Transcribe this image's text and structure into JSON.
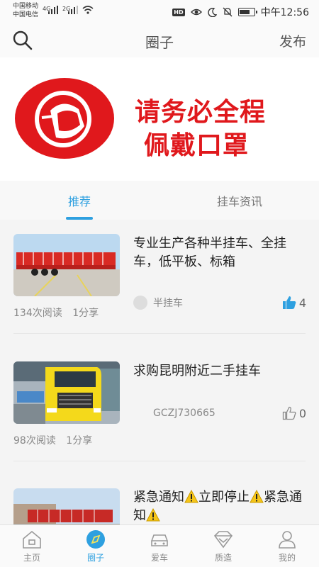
{
  "status_bar": {
    "carrier1": "中国移动",
    "carrier2": "中国电信",
    "net1": "4G",
    "net2": "2G",
    "hd": "HD",
    "time": "中午12:56"
  },
  "header": {
    "title": "圈子",
    "publish_label": "发布"
  },
  "banner": {
    "line1": "请务必全程",
    "line2": "佩戴口罩",
    "accent_color": "#e0181c"
  },
  "tabs": [
    {
      "label": "推荐",
      "active": true
    },
    {
      "label": "挂车资讯",
      "active": false
    }
  ],
  "posts": [
    {
      "title": "专业生产各种半挂车、全挂车，低平板、标箱",
      "author": "半挂车",
      "likes": "4",
      "liked": true,
      "reads": "134次阅读",
      "shares": "1分享"
    },
    {
      "title": "求购昆明附近二手挂车",
      "author": "GCZJ730665",
      "likes": "0",
      "liked": false,
      "reads": "98次阅读",
      "shares": "1分享"
    },
    {
      "title_part1": "紧急通知",
      "title_part2": "立即停止",
      "title_part3": "紧急通知"
    }
  ],
  "bottom_nav": [
    {
      "label": "主页",
      "icon": "home-icon"
    },
    {
      "label": "圈子",
      "icon": "circle-icon",
      "active": true
    },
    {
      "label": "爱车",
      "icon": "car-icon"
    },
    {
      "label": "质造",
      "icon": "diamond-icon"
    },
    {
      "label": "我的",
      "icon": "person-icon"
    }
  ],
  "colors": {
    "accent": "#2ea0e0",
    "warning": "#f5c518"
  }
}
